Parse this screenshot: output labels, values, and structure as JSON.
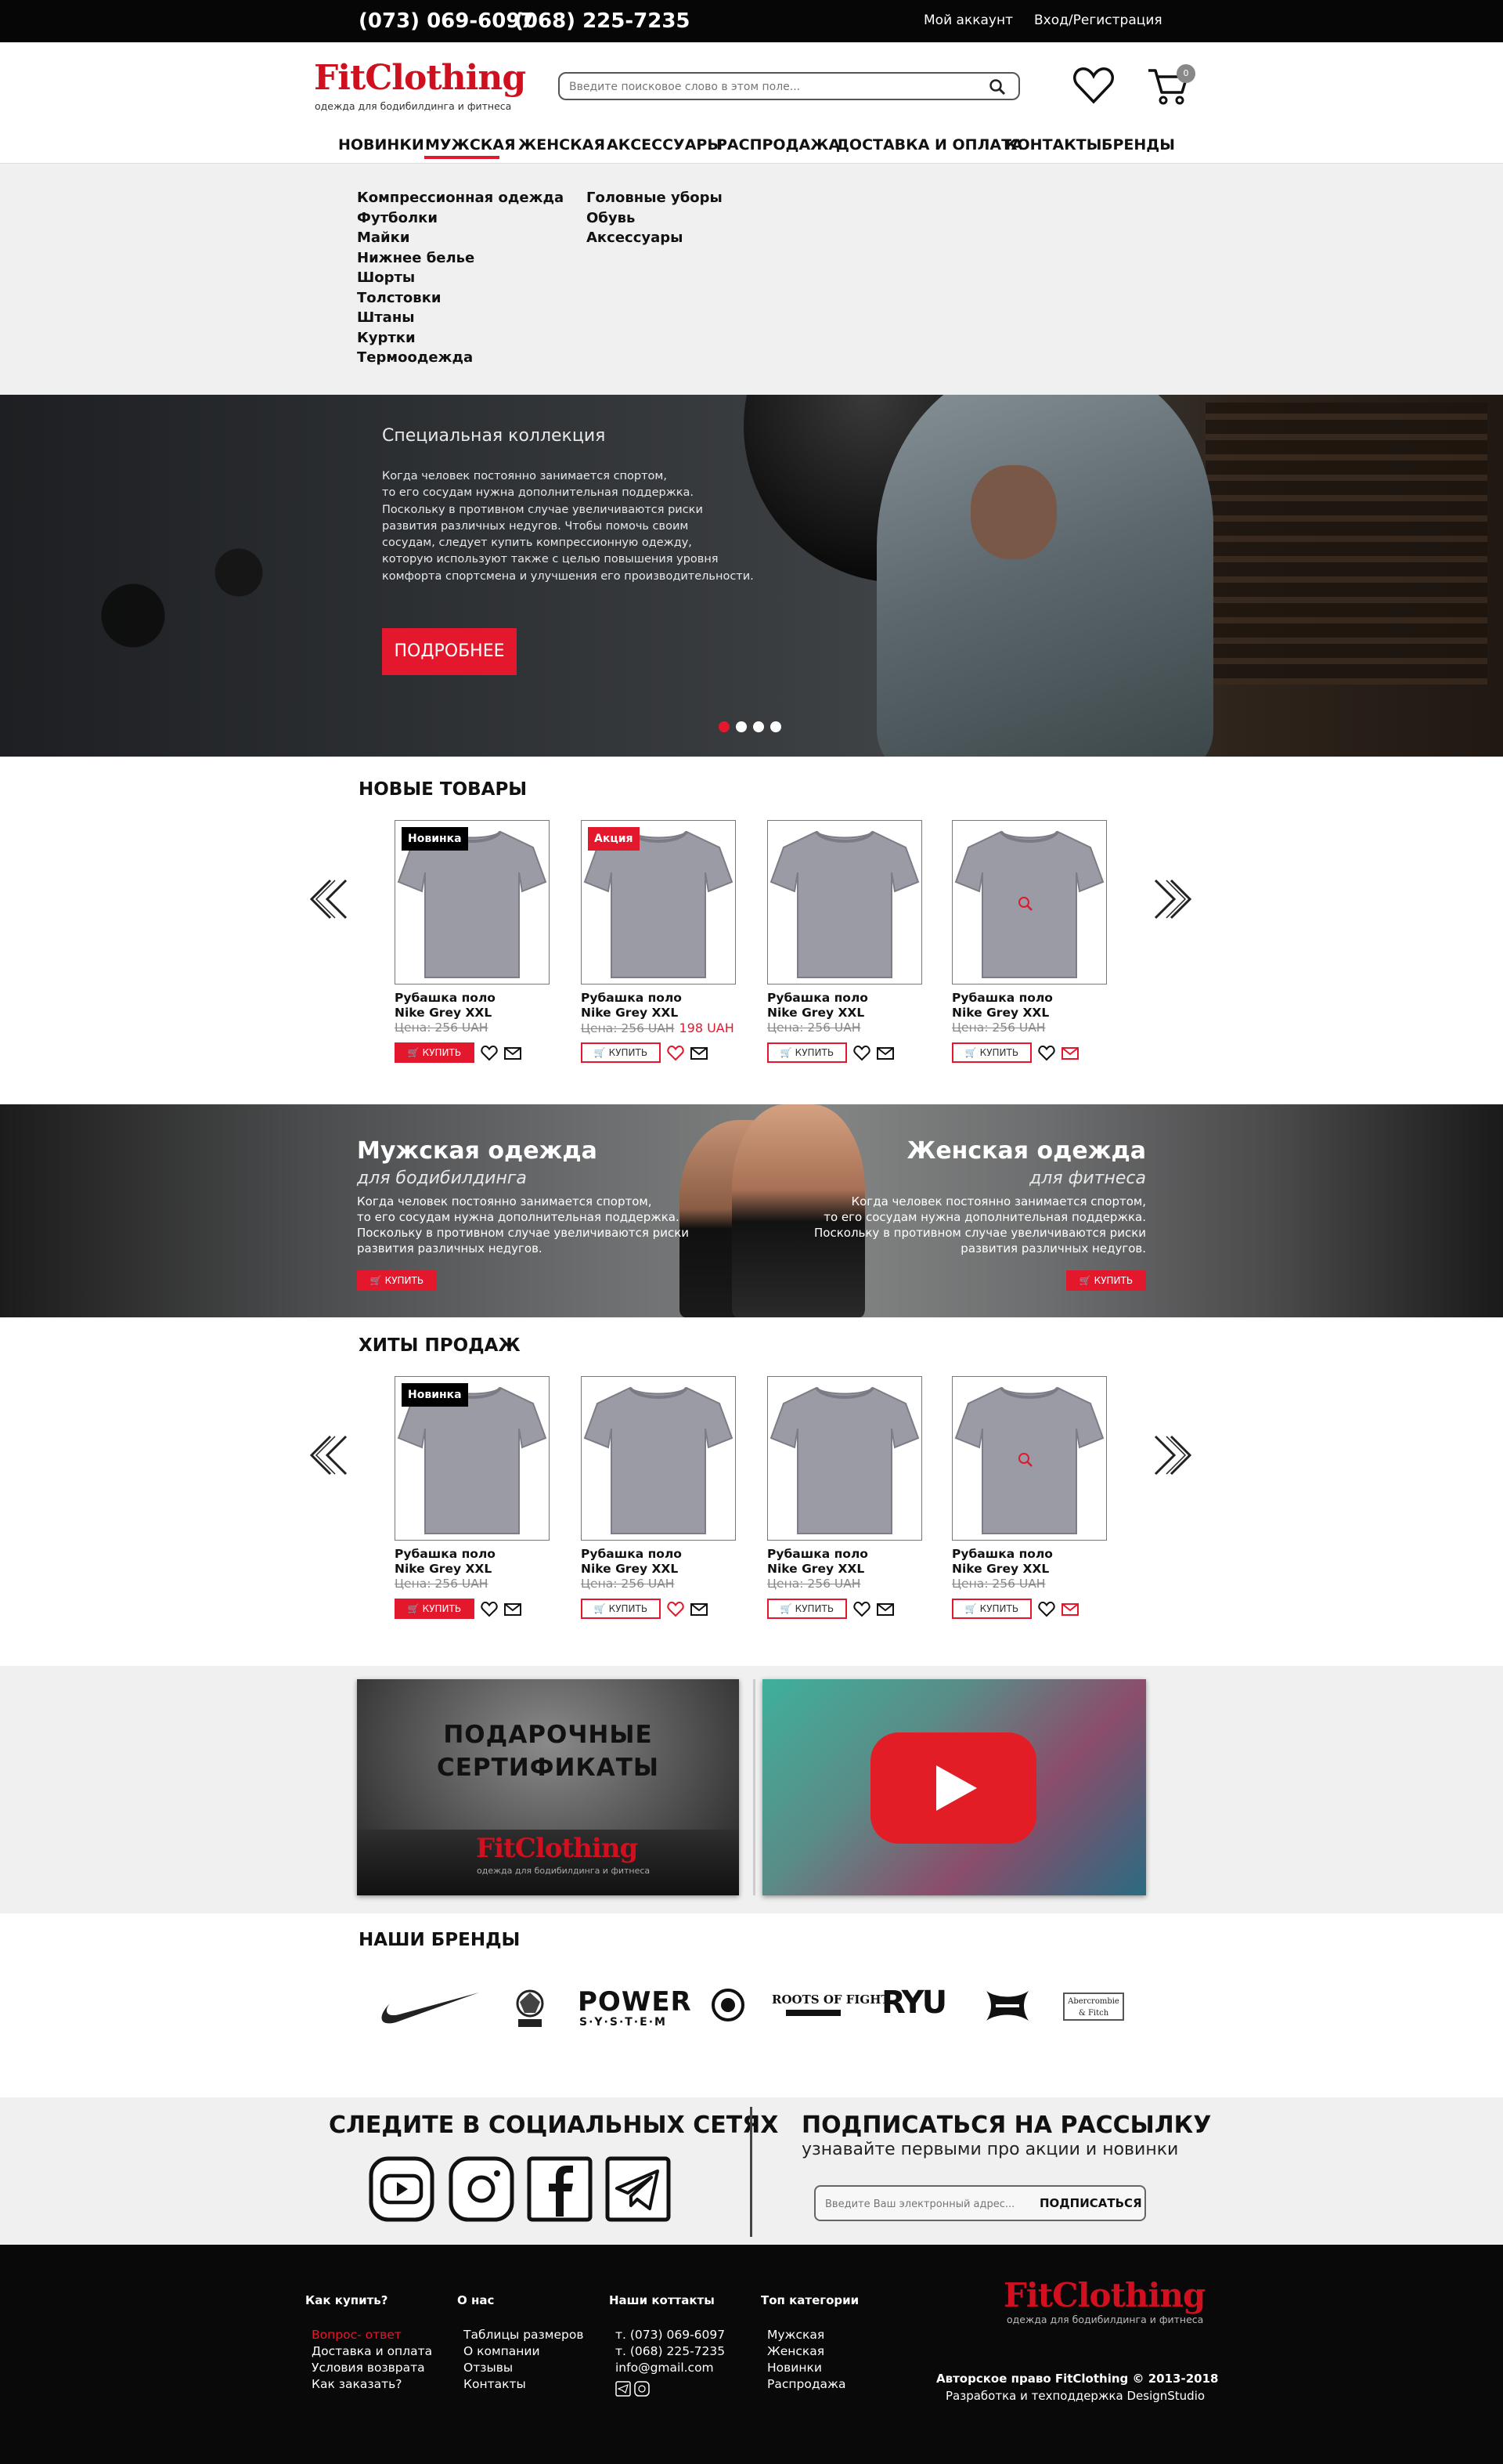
{
  "topbar": {
    "phone1": "(073) 069-6097",
    "phone2": "(068) 225-7235",
    "account": "Мой аккаунт",
    "login": "Вход/Регистрация"
  },
  "header": {
    "logo": "FitClothing",
    "tagline": "одежда для бодибилдинга и фитнеса",
    "search_placeholder": "Введите поисковое слово в этом поле...",
    "cart_count": "0"
  },
  "nav": [
    "НОВИНКИ",
    "МУЖСКАЯ",
    "ЖЕНСКАЯ",
    "АКСЕССУАРЫ",
    "РАСПРОДАЖА",
    "ДОСТАВКА И ОПЛАТА",
    "КОНТАКТЫ",
    "БРЕНДЫ"
  ],
  "megamenu": {
    "col1": [
      "Компрессионная одежда",
      "Футболки",
      "Майки",
      "Нижнее белье",
      "Шорты",
      "Толстовки",
      "Штаны",
      "Куртки",
      "Термоодежда"
    ],
    "col2": [
      "Головные уборы",
      "Обувь",
      "Аксессуары"
    ]
  },
  "hero": {
    "subtitle": "Специальная коллекция",
    "text": [
      "Когда человек постоянно занимается спортом,",
      "то его сосудам нужна дополнительная поддержка.",
      "Поскольку в противном случае увеличиваются риски",
      "развития различных недугов. Чтобы помочь своим",
      "сосудам, следует купить компрессионную одежду,",
      "которую используют также с целью повышения уровня",
      "комфорта спортсмена и улучшения его производительности."
    ],
    "button": "ПОДРОБНЕЕ",
    "active_slide": 1,
    "slides": 4
  },
  "new_products": {
    "title": "НОВЫЕ ТОВАРЫ",
    "items": [
      {
        "badge": "Новинка",
        "badge_color": "#000000",
        "name1": "Рубашка поло",
        "name2": "Nike Grey XXL",
        "price": "Цена: 256 UAH",
        "new_price": "",
        "buy": "КУПИТЬ",
        "buy_filled": true
      },
      {
        "badge": "Акция",
        "badge_color": "#e3182d",
        "name1": "Рубашка поло",
        "name2": "Nike Grey XXL",
        "price": "Цена: 256 UAH",
        "new_price": "198 UAH",
        "buy": "КУПИТЬ",
        "buy_filled": false
      },
      {
        "badge": "",
        "badge_color": "",
        "name1": "Рубашка поло",
        "name2": "Nike Grey XXL",
        "price": "Цена: 256 UAH",
        "new_price": "",
        "buy": "КУПИТЬ",
        "buy_filled": false
      },
      {
        "badge": "",
        "badge_color": "",
        "name1": "Рубашка поло",
        "name2": "Nike Grey XXL",
        "price": "Цена: 256 UAH",
        "new_price": "",
        "buy": "КУПИТЬ",
        "buy_filled": false
      }
    ]
  },
  "banner": {
    "left_title": "Мужская одежда",
    "left_sub": "для бодибилдинга",
    "right_title": "Женская одежда",
    "right_sub": "для фитнеса",
    "text": [
      "Когда человек постоянно занимается спортом,",
      "то его сосудам нужна дополнительная поддержка.",
      "Поскольку в противном случае увеличиваются риски",
      "развития различных недугов."
    ],
    "button": "КУПИТЬ"
  },
  "hits": {
    "title": "ХИТЫ ПРОДАЖ",
    "items": [
      {
        "badge": "Новинка",
        "badge_color": "#000000",
        "name1": "Рубашка поло",
        "name2": "Nike Grey XXL",
        "price": "Цена: 256 UAH",
        "new_price": "",
        "buy": "КУПИТЬ",
        "buy_filled": true
      },
      {
        "badge": "",
        "badge_color": "",
        "name1": "Рубашка поло",
        "name2": "Nike Grey XXL",
        "price": "Цена: 256 UAH",
        "new_price": "",
        "buy": "КУПИТЬ",
        "buy_filled": false
      },
      {
        "badge": "",
        "badge_color": "",
        "name1": "Рубашка поло",
        "name2": "Nike Grey XXL",
        "price": "Цена: 256 UAH",
        "new_price": "",
        "buy": "КУПИТЬ",
        "buy_filled": false
      },
      {
        "badge": "",
        "badge_color": "",
        "name1": "Рубашка поло",
        "name2": "Nike Grey XXL",
        "price": "Цена: 256 UAH",
        "new_price": "",
        "buy": "КУПИТЬ",
        "buy_filled": false
      }
    ]
  },
  "promo": {
    "gift_line1": "ПОДАРОЧНЫЕ",
    "gift_line2": "СЕРТИФИКАТЫ",
    "gift_logo": "FitClothing",
    "gift_tagline": "одежда для бодибилдинга и фитнеса"
  },
  "brands": {
    "title": "НАШИ БРЕНДЫ",
    "items": [
      "nike",
      "ifbb",
      "power-system",
      "roots-of-fight",
      "ryu",
      "under-armour",
      "abercrombie-fitch"
    ],
    "power_text": "POWER",
    "power_sub": "S·Y·S·T·E·M",
    "rof_text": "ROOTS OF FIGHT",
    "ryu_text": "RYU",
    "af_text": "Abercrombie & Fitch"
  },
  "social": {
    "title": "СЛЕДИТЕ В СОЦИАЛЬНЫХ СЕТЯХ",
    "icons": [
      "youtube-icon",
      "instagram-icon",
      "facebook-icon",
      "telegram-icon"
    ]
  },
  "newsletter": {
    "title": "ПОДПИСАТЬСЯ НА РАССЫЛКУ",
    "subtitle": "узнавайте первыми про акции и новинки",
    "placeholder": "Введите Ваш электронный адрес...",
    "button": "ПОДПИСАТЬСЯ"
  },
  "footer": {
    "col1_title": "Как купить?",
    "col1": [
      "Вопрос- ответ",
      "Доставка и оплата",
      "Условия возврата",
      "Как заказать?"
    ],
    "col2_title": "О нас",
    "col2": [
      "Таблицы размеров",
      "О компании",
      "Отзывы",
      "Контакты"
    ],
    "col3_title": "Наши коттакты",
    "col3": [
      "т. (073) 069-6097",
      "т. (068) 225-7235",
      "info@gmail.com"
    ],
    "col4_title": "Топ категории",
    "col4": [
      "Мужская",
      "Женская",
      "Новинки",
      "Распродажа"
    ],
    "logo": "FitClothing",
    "tagline": "одежда для бодибилдинга и фитнеса",
    "copyright": "Авторское право FitClothing © 2013-2018",
    "developer": "Разработка и техподдержка DesignStudio",
    "accent": "#e3182d"
  }
}
